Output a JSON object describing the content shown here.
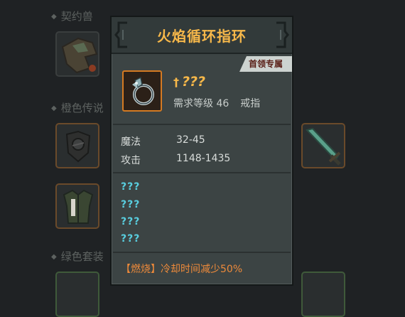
{
  "background": {
    "headers": [
      "契约兽",
      "橙色传说",
      "绿色套装"
    ]
  },
  "tooltip": {
    "title": "火焰循环指环",
    "boss_tag": "首领专属",
    "item_name": "???",
    "required_level_label": "需求等级 46",
    "slot_type": "戒指",
    "stats": [
      {
        "label": "魔法",
        "value": "32-45"
      },
      {
        "label": "攻击",
        "value": "1148-1435"
      }
    ],
    "unknown_stats": [
      "???",
      "???",
      "???",
      "???"
    ],
    "effect": "【燃烧】冷却时间减少50%"
  },
  "colors": {
    "title": "#f7b84a",
    "unknown_stat": "#59cfe0",
    "effect": "#ee8a3a",
    "icon_border": "#d47a22"
  }
}
